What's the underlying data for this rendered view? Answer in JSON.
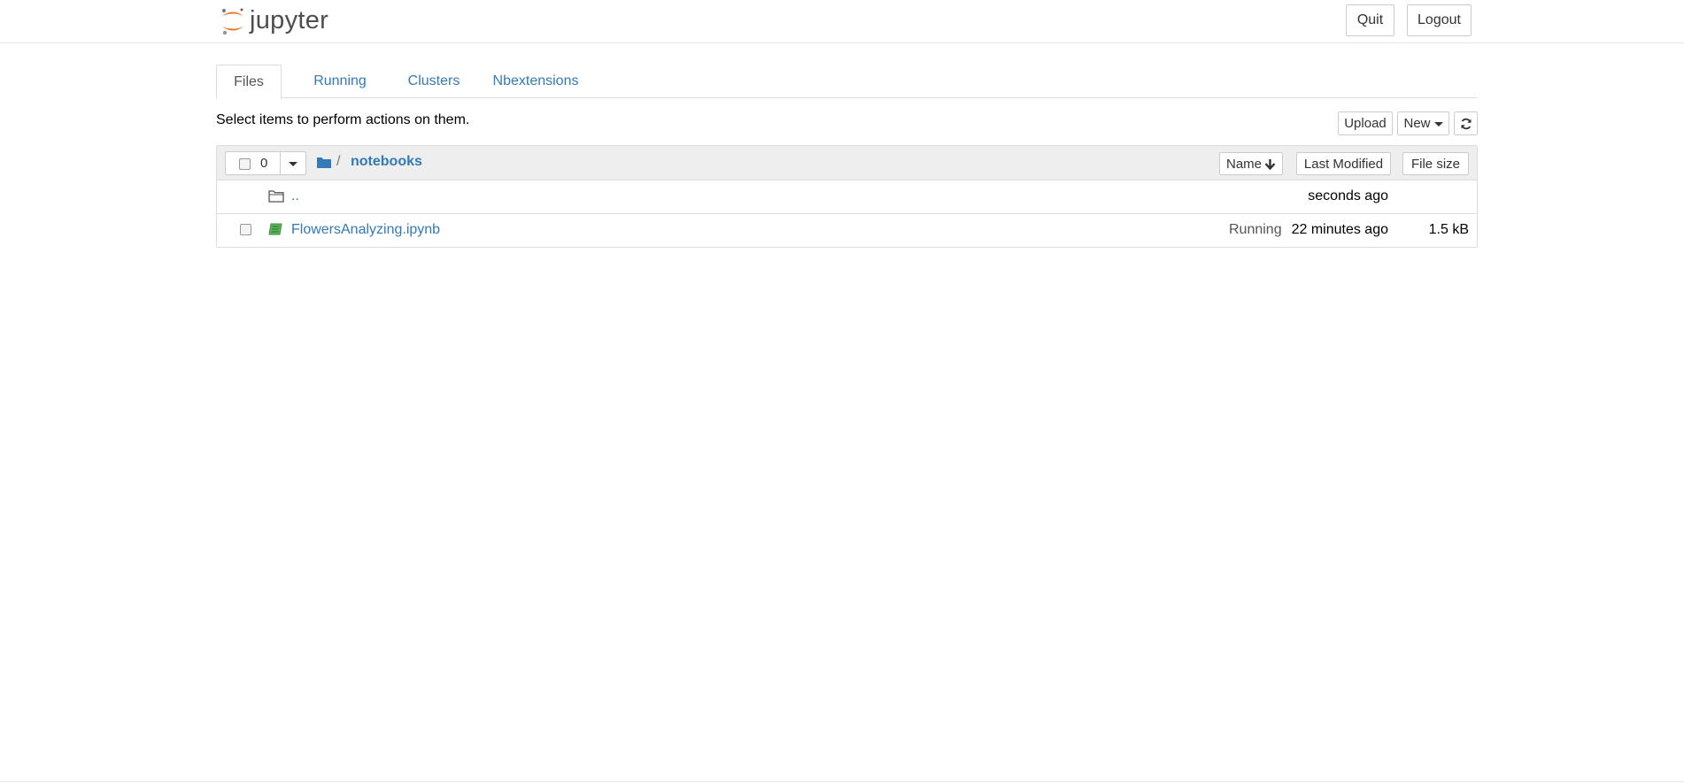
{
  "header": {
    "logo_text": "jupyter",
    "quit_label": "Quit",
    "logout_label": "Logout"
  },
  "tabs": [
    {
      "label": "Files",
      "active": true
    },
    {
      "label": "Running",
      "active": false
    },
    {
      "label": "Clusters",
      "active": false
    },
    {
      "label": "Nbextensions",
      "active": false
    }
  ],
  "toolbar": {
    "hint": "Select items to perform actions on them.",
    "upload_label": "Upload",
    "new_label": "New",
    "refresh_icon": "refresh-icon"
  },
  "list": {
    "selected_count": "0",
    "breadcrumb": {
      "separator": "/",
      "folder": "notebooks"
    },
    "sort": {
      "name_label": "Name",
      "modified_label": "Last Modified",
      "size_label": "File size"
    },
    "rows": [
      {
        "name": "..",
        "icon": "folder-icon",
        "status": "",
        "modified": "seconds ago",
        "size": ""
      },
      {
        "name": "FlowersAnalyzing.ipynb",
        "icon": "notebook-icon",
        "status": "Running",
        "modified": "22 minutes ago",
        "size": "1.5 kB"
      }
    ]
  },
  "colors": {
    "link": "#337ab7",
    "brand_orange": "#f37726",
    "header_bg": "#eeeeee",
    "notebook_green": "#5cb85c"
  }
}
